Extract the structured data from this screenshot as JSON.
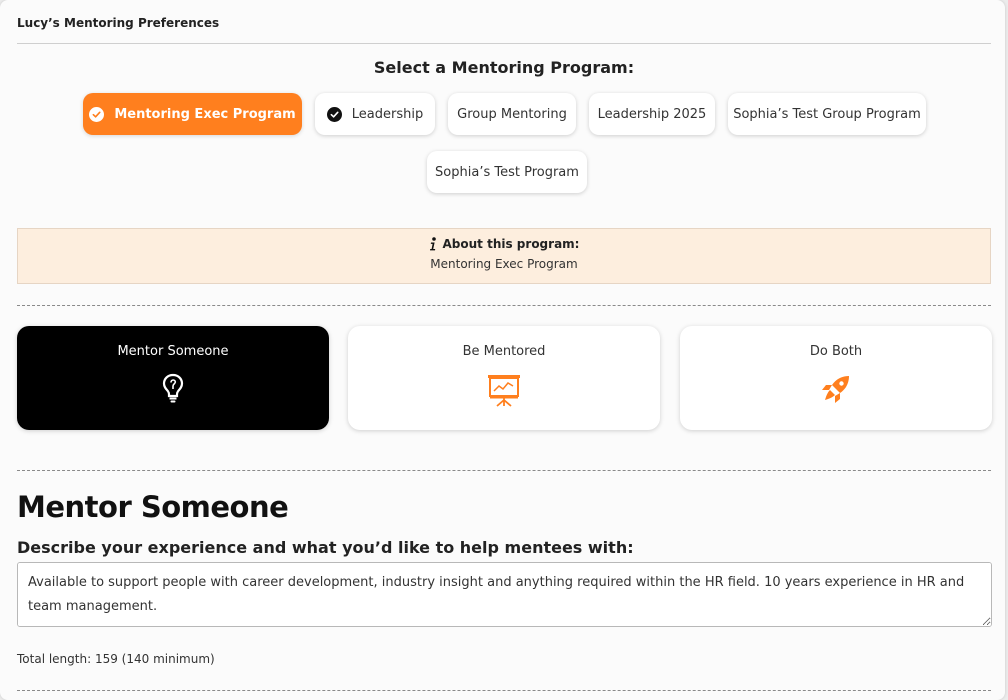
{
  "header": {
    "title": "Lucy’s Mentoring Preferences"
  },
  "programs": {
    "heading": "Select a Mentoring Program:",
    "items": [
      {
        "label": "Mentoring Exec Program",
        "selected": true
      },
      {
        "label": "Leadership",
        "checked": true
      },
      {
        "label": "Group Mentoring"
      },
      {
        "label": "Leadership 2025"
      },
      {
        "label": "Sophia’s Test Group Program"
      },
      {
        "label": "Sophia’s Test Program"
      }
    ]
  },
  "about": {
    "title": "About this program:",
    "text": "Mentoring Exec Program"
  },
  "roles": [
    {
      "label": "Mentor Someone",
      "icon": "lightbulb-icon",
      "selected": true
    },
    {
      "label": "Be Mentored",
      "icon": "presentation-board-icon"
    },
    {
      "label": "Do Both",
      "icon": "rocket-icon"
    }
  ],
  "mentor": {
    "title": "Mentor Someone",
    "prompt": "Describe your experience and what you’d like to help mentees with:",
    "value": "Available to support people with career development, industry insight and anything required within the HR field. 10 years experience in HR and team management.",
    "counter": "Total length: 159 (140 minimum)"
  },
  "colors": {
    "accent": "#ff7f1e",
    "info_bg": "#fdeede",
    "selected_card": "#000000"
  }
}
